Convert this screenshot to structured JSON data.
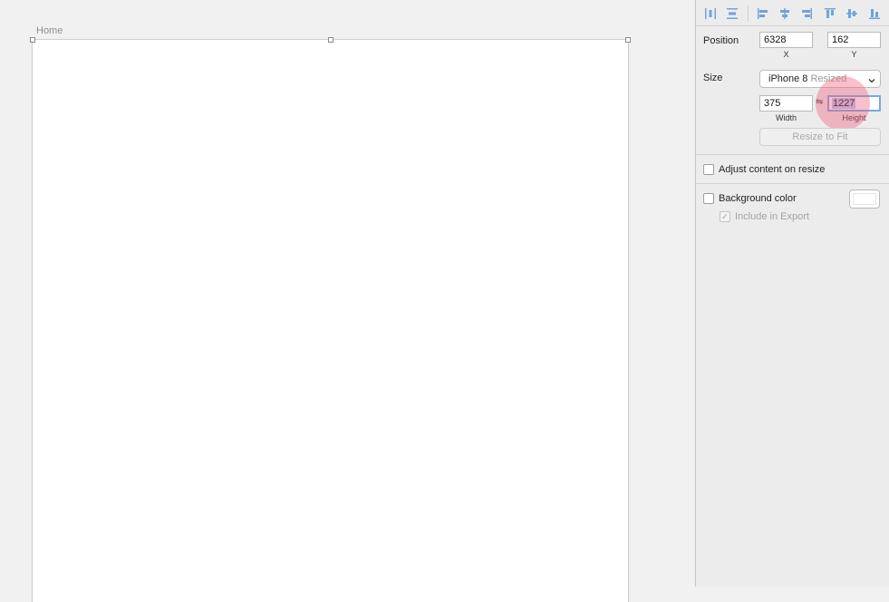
{
  "artboard": {
    "title": "Home"
  },
  "inspector": {
    "align_icons": [
      "distribute-horizontal-icon",
      "distribute-vertical-icon",
      "align-left-icon",
      "align-center-icon",
      "align-right-icon",
      "align-top-icon",
      "align-middle-icon",
      "align-bottom-icon"
    ],
    "position": {
      "label": "Position",
      "x_value": "6328",
      "x_label": "X",
      "y_value": "162",
      "y_label": "Y"
    },
    "size": {
      "label": "Size",
      "preset_main": "iPhone 8",
      "preset_suffix": "Resized",
      "width_value": "375",
      "width_label": "Width",
      "link_icon": "⇋",
      "height_value": "1227",
      "height_label": "Height",
      "resize_to_fit": "Resize to Fit"
    },
    "adjust_content": {
      "label": "Adjust content on resize",
      "checked": false
    },
    "background": {
      "label": "Background color",
      "checked": false,
      "swatch_color": "#ffffff"
    },
    "include_in_export": {
      "label": "Include in Export",
      "checked": true,
      "enabled": false
    }
  },
  "colors": {
    "accent": "#7aa8e6",
    "click_indicator": "#f05a78"
  }
}
